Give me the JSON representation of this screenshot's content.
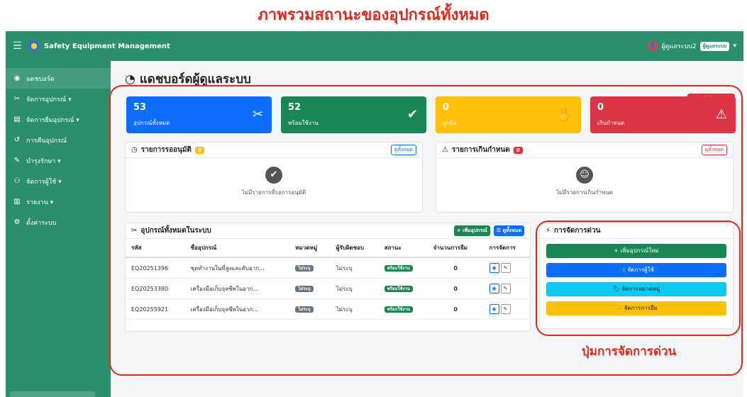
{
  "caption_top": "ภาพรวมสถานะของอุปกรณ์ทั้งหมด",
  "caption_bottom": "ปุ่มการจัดการด่วน",
  "app": {
    "brand": "Safety Equipment Management",
    "user_name": "ผู้ดูแลระบบ2",
    "user_role": "ผู้ดูแลระบบ"
  },
  "sidebar": {
    "items": [
      {
        "label": "แดชบอร์ด",
        "icon": "dashboard-icon"
      },
      {
        "label": "จัดการอุปกรณ์ ▾",
        "icon": "tools-icon"
      },
      {
        "label": "จัดการยืมอุปกรณ์ ▾",
        "icon": "clipboard-icon"
      },
      {
        "label": "การคืนอุปกรณ์",
        "icon": "undo-icon"
      },
      {
        "label": "บำรุงรักษา ▾",
        "icon": "wrench-icon"
      },
      {
        "label": "จัดการผู้ใช้ ▾",
        "icon": "users-icon"
      },
      {
        "label": "รายงาน ▾",
        "icon": "chart-icon"
      },
      {
        "label": "ตั้งค่าระบบ",
        "icon": "gear-icon"
      }
    ]
  },
  "page": {
    "title": "แดชบอร์ดผู้ดูแลระบบ",
    "role_badge": "Administrator"
  },
  "stats": [
    {
      "value": "53",
      "label": "อุปกรณ์ทั้งหมด",
      "color": "#0d6efd",
      "icon": "tools-icon"
    },
    {
      "value": "52",
      "label": "พร้อมใช้งาน",
      "color": "#198754",
      "icon": "check-circle-icon"
    },
    {
      "value": "0",
      "label": "ถูกยืม",
      "color": "#ffc107",
      "icon": "handshake-icon"
    },
    {
      "value": "0",
      "label": "เกินกำหนด",
      "color": "#dc3545",
      "icon": "warning-icon"
    }
  ],
  "pending": {
    "title": "รายการรออนุมัติ",
    "count": "0",
    "view_all": "ดูทั้งหมด",
    "empty": "ไม่มีรายการที่รอการอนุมัติ"
  },
  "overdue": {
    "title": "รายการเกินกำหนด",
    "count": "0",
    "view_all": "ดูทั้งหมด",
    "empty": "ไม่มีรายการเกินกำหนด"
  },
  "equipment": {
    "title": "อุปกรณ์ทั้งหมดในระบบ",
    "add_label": "+ เพิ่มอุปกรณ์",
    "view_all_label": "☰ ดูทั้งหมด",
    "columns": [
      "รหัส",
      "ชื่ออุปกรณ์",
      "หมวดหมู่",
      "ผู้รับผิดชอบ",
      "สถานะ",
      "จำนวนการยืม",
      "การจัดการ"
    ],
    "rows": [
      {
        "code": "EQ20251396",
        "name": "ชุดทำงานในที่สูงและดับอาก...",
        "category": "ไม่ระบุ",
        "owner": "ไม่ระบุ",
        "status": "พร้อมใช้งาน",
        "borrows": "0"
      },
      {
        "code": "EQ20253380",
        "name": "เครื่องมือเก็บจุลชีพในอาก...",
        "category": "ไม่ระบุ",
        "owner": "ไม่ระบุ",
        "status": "พร้อมใช้งาน",
        "borrows": "0"
      },
      {
        "code": "EQ20255921",
        "name": "เครื่องมือเก็บจุลชีพในอาก...",
        "category": "ไม่ระบุ",
        "owner": "ไม่ระบุ",
        "status": "พร้อมใช้งาน",
        "borrows": "0"
      }
    ]
  },
  "quick": {
    "title": "การจัดการด่วน",
    "buttons": [
      {
        "label": "+ เพิ่มอุปกรณ์ใหม่",
        "color": "#198754"
      },
      {
        "label": "👥 จัดการผู้ใช้",
        "color": "#0d6efd"
      },
      {
        "label": "🏷 จัดการหมวดหมู่",
        "color": "#0dcaf0"
      },
      {
        "label": "🤝 จัดการการยืม",
        "color": "#ffc107"
      }
    ]
  }
}
